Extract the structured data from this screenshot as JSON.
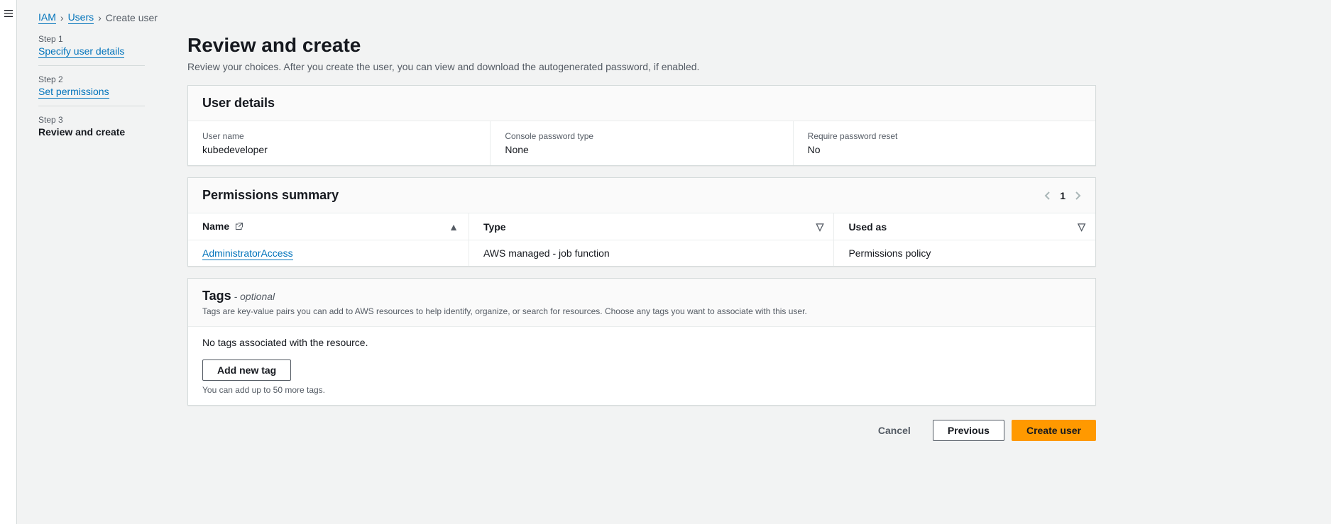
{
  "breadcrumb": {
    "iam": "IAM",
    "users": "Users",
    "current": "Create user"
  },
  "steps": [
    {
      "num": "Step 1",
      "label": "Specify user details"
    },
    {
      "num": "Step 2",
      "label": "Set permissions"
    },
    {
      "num": "Step 3",
      "label": "Review and create"
    }
  ],
  "page": {
    "title": "Review and create",
    "subtitle": "Review your choices. After you create the user, you can view and download the autogenerated password, if enabled."
  },
  "user_details": {
    "heading": "User details",
    "username_label": "User name",
    "username_value": "kubedeveloper",
    "pwdtype_label": "Console password type",
    "pwdtype_value": "None",
    "reset_label": "Require password reset",
    "reset_value": "No"
  },
  "permissions": {
    "heading": "Permissions summary",
    "page_current": "1",
    "col_name": "Name",
    "col_type": "Type",
    "col_used": "Used as",
    "row_name": "AdministratorAccess",
    "row_type": "AWS managed - job function",
    "row_used": "Permissions policy"
  },
  "tags": {
    "heading": "Tags",
    "optional": " - optional",
    "desc": "Tags are key-value pairs you can add to AWS resources to help identify, organize, or search for resources. Choose any tags you want to associate with this user.",
    "none": "No tags associated with the resource.",
    "add_button": "Add new tag",
    "hint": "You can add up to 50 more tags."
  },
  "actions": {
    "cancel": "Cancel",
    "previous": "Previous",
    "create": "Create user"
  }
}
